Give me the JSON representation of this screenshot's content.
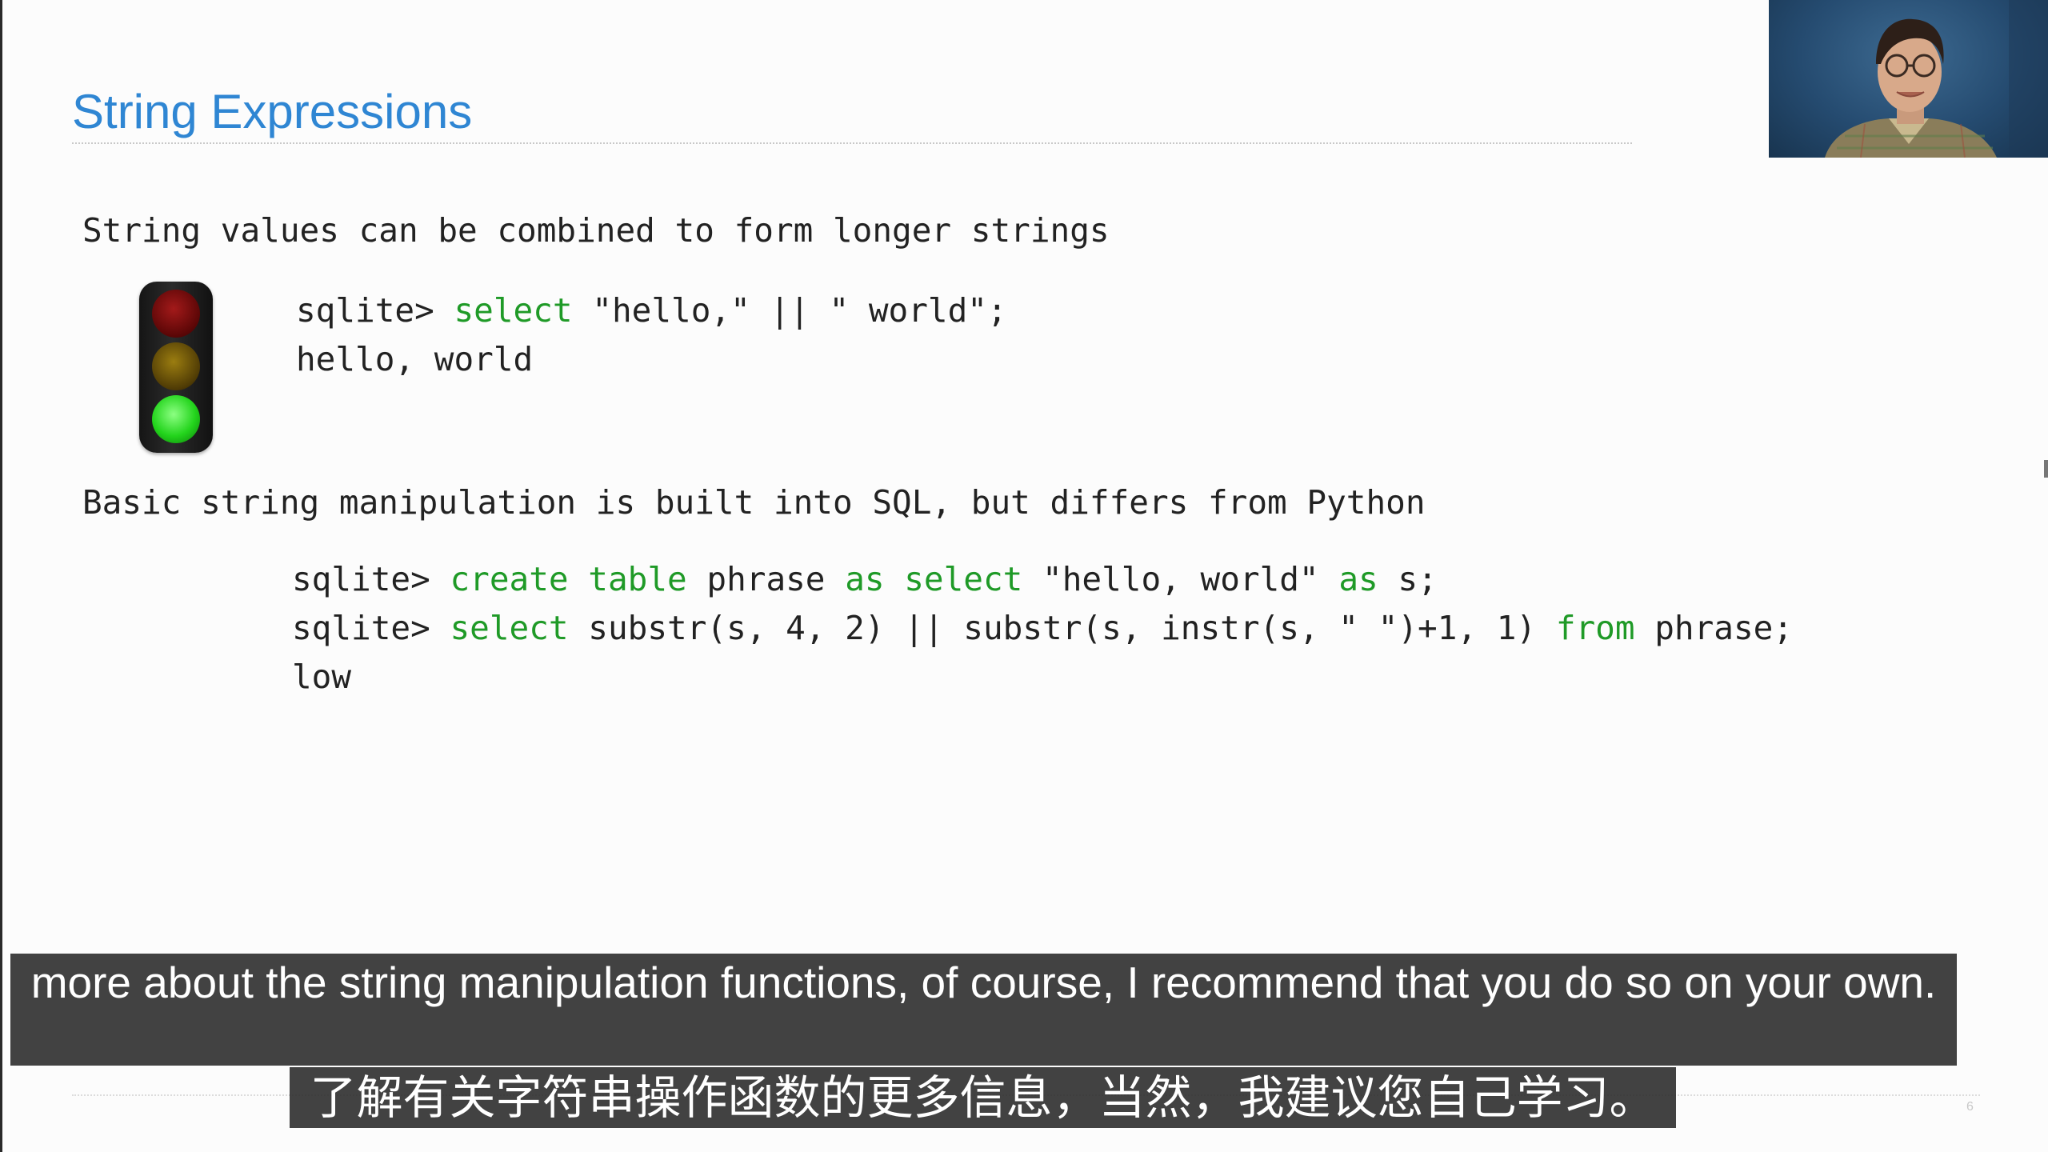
{
  "slide": {
    "title": "String Expressions",
    "page_number": "6",
    "bullets": [
      "String values can be combined to form longer strings",
      "Basic string manipulation is built into SQL, but differs from Python"
    ],
    "code_block_1": [
      [
        {
          "text": "sqlite> ",
          "kw": false
        },
        {
          "text": "select",
          "kw": true
        },
        {
          "text": " \"hello,\" || \" world\";",
          "kw": false
        }
      ],
      [
        {
          "text": "hello, world",
          "kw": false
        }
      ]
    ],
    "code_block_2": [
      [
        {
          "text": "sqlite> ",
          "kw": false
        },
        {
          "text": "create table",
          "kw": true
        },
        {
          "text": " phrase ",
          "kw": false
        },
        {
          "text": "as",
          "kw": true
        },
        {
          "text": " ",
          "kw": false
        },
        {
          "text": "select",
          "kw": true
        },
        {
          "text": " \"hello, world\" ",
          "kw": false
        },
        {
          "text": "as",
          "kw": true
        },
        {
          "text": " s;",
          "kw": false
        }
      ],
      [
        {
          "text": "sqlite> ",
          "kw": false
        },
        {
          "text": "select",
          "kw": true
        },
        {
          "text": " substr(s, 4, 2) || substr(s, instr(s, \" \")+1, 1) ",
          "kw": false
        },
        {
          "text": "from",
          "kw": true
        },
        {
          "text": " phrase;",
          "kw": false
        }
      ],
      [
        {
          "text": "low",
          "kw": false
        }
      ]
    ],
    "traffic_light": {
      "red": "off",
      "yellow": "off",
      "green": "on"
    }
  },
  "colors": {
    "title": "#2f86d3",
    "keyword": "#1f9a27",
    "text": "#222222",
    "caption_bg": "#282828"
  },
  "webcam": {
    "icon": "presenter-video"
  },
  "captions": {
    "english": "more about the string manipulation functions, of course, I recommend that you do so on your own.",
    "chinese": "了解有关字符串操作函数的更多信息，当然，我建议您自己学习。"
  }
}
